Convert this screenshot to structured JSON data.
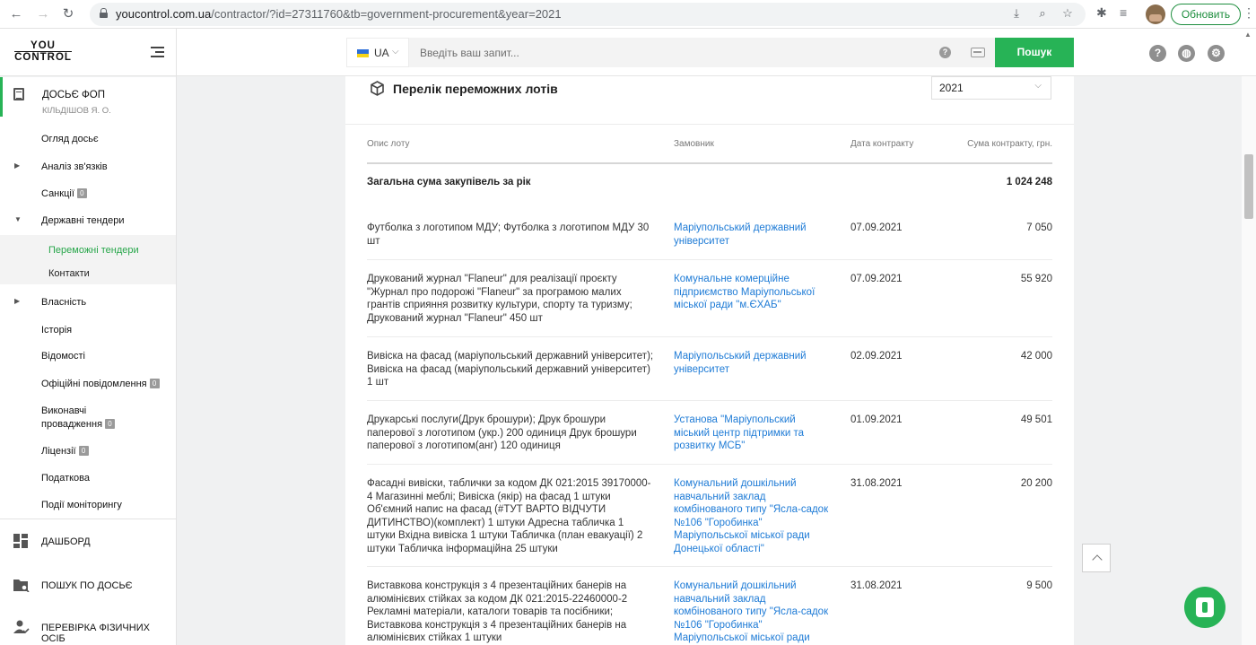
{
  "browser": {
    "url_host": "youcontrol.com.ua",
    "url_path": "/contractor/?id=27311760&tb=government-procurement&year=2021",
    "update_label": "Обновить"
  },
  "header": {
    "logo_line1": "YOU",
    "logo_line2": "CONTROL",
    "lang_code": "UA",
    "search_placeholder": "Введіть ваш запит...",
    "search_button": "Пошук",
    "help_glyph": "?"
  },
  "sidebar": {
    "dossier_title": "ДОСЬЄ ФОП",
    "dossier_subtitle": "КІЛЬДІШОВ Я. О.",
    "items": [
      {
        "label": "Огляд досьє"
      },
      {
        "label": "Аналіз зв'язків"
      },
      {
        "label": "Санкції",
        "badge": "0"
      },
      {
        "label": "Державні тендери"
      },
      {
        "label": "Власність"
      },
      {
        "label": "Історія"
      },
      {
        "label": "Відомості"
      },
      {
        "label": "Офіційні повідомлення",
        "badge": "0"
      },
      {
        "label_line1": "Виконавчі",
        "label_line2": "провадження",
        "badge": "0"
      },
      {
        "label": "Ліцензії",
        "badge": "0"
      },
      {
        "label": "Податкова"
      },
      {
        "label": "Події моніторингу"
      }
    ],
    "sub_items": [
      "Переможні тендери",
      "Контакти"
    ],
    "bottom": [
      "ДАШБОРД",
      "ПОШУК ПО ДОСЬЄ",
      "ПЕРЕВІРКА ФІЗИЧНИХ ОСІБ"
    ]
  },
  "main": {
    "title": "Перелік переможних лотів",
    "year": "2021",
    "columns": [
      "Опис лоту",
      "Замовник",
      "Дата контракту",
      "Сума контракту, грн."
    ],
    "total_label": "Загальна сума закупівель за рік",
    "total_amount": "1 024 248",
    "rows": [
      {
        "desc": "Футболка з логотипом МДУ; Футболка з логотипом МДУ 30 шт",
        "customer": "Маріупольський державний університет",
        "date": "07.09.2021",
        "amount": "7 050"
      },
      {
        "desc": "Друкований журнал \"Flaneur\" для реалізації проєкту \"Журнал про подорожі \"Flaneur\" за програмою малих грантів сприяння розвитку культури, спорту та туризму; Друкований журнал \"Flaneur\" 450 шт",
        "customer": "Комунальне комерційне підприємство Маріупольської міської ради \"м.ЄХАБ\"",
        "date": "07.09.2021",
        "amount": "55 920"
      },
      {
        "desc": "Вивіска на фасад (маріупольський державний університет); Вивіска на фасад (маріупольський державний університет) 1 шт",
        "customer": "Маріупольський державний університет",
        "date": "02.09.2021",
        "amount": "42 000"
      },
      {
        "desc": "Друкарські послуги(Друк брошури); Друк брошури паперової з логотипом (укр.) 200 одиниця Друк брошури паперової з логотипом(анг) 120 одиниця",
        "customer": "Установа \"Маріупольский міський центр підтримки та розвитку МСБ\"",
        "date": "01.09.2021",
        "amount": "49 501"
      },
      {
        "desc": "Фасадні вивіски, таблички за кодом ДК 021:2015 39170000-4 Магазинні меблі; Вивіска (якір) на фасад 1 штуки Об'ємний напис на фасад (#ТУТ ВАРТО ВІДЧУТИ ДИТИНСТВО)(комплект) 1 штуки Адресна табличка 1 штуки Вхідна вивіска 1 штуки Табличка (план евакуації) 2 штуки Табличка інформаційна 25 штуки",
        "customer": "Комунальний дошкільний навчальний заклад комбінованого типу \"Ясла-садок №106 \"Горобинка\" Маріупольської міської ради Донецької області\"",
        "date": "31.08.2021",
        "amount": "20 200"
      },
      {
        "desc": "Виставкова конструкція з 4 презентаційних банерів на алюмінієвих стійках за кодом ДК 021:2015-22460000-2 Рекламні матеріали, каталоги товарів та посібники; Виставкова конструкція з 4 презентаційних банерів на алюмінієвих стійках 1 штуки",
        "customer": "Комунальний дошкільний навчальний заклад комбінованого типу \"Ясла-садок №106 \"Горобинка\" Маріупольської міської ради",
        "date": "31.08.2021",
        "amount": "9 500"
      }
    ]
  }
}
